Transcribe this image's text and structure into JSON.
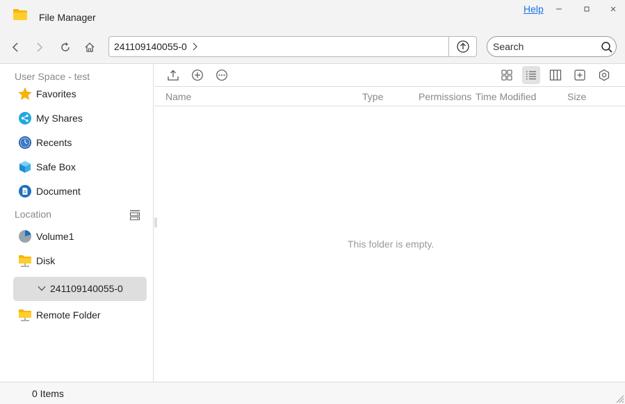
{
  "window": {
    "title": "File Manager",
    "help_label": "Help",
    "minimize_icon": "minimize-icon",
    "maximize_icon": "maximize-icon",
    "close_icon": "close-icon"
  },
  "navbar": {
    "back_icon": "chevron-left-icon",
    "forward_icon": "chevron-right-icon",
    "refresh_icon": "refresh-icon",
    "home_icon": "home-icon",
    "path": "241109140055-0",
    "up_icon": "upload-circle-icon",
    "search": {
      "placeholder": "Search",
      "value": ""
    }
  },
  "sidebar": {
    "user_space_label": "User Space - test",
    "items": [
      {
        "label": "Favorites",
        "icon": "star-icon"
      },
      {
        "label": "My Shares",
        "icon": "share-icon"
      },
      {
        "label": "Recents",
        "icon": "clock-icon"
      },
      {
        "label": "Safe Box",
        "icon": "cube-icon"
      },
      {
        "label": "Document",
        "icon": "document-icon"
      }
    ],
    "location_label": "Location",
    "locations": [
      {
        "label": "Volume1",
        "icon": "pie-disk-icon"
      },
      {
        "label": "Disk",
        "icon": "folder-icon"
      }
    ],
    "selected_device": "241109140055-0",
    "remote_folder_label": "Remote Folder"
  },
  "content": {
    "toolbar_icons": [
      "upload-icon",
      "add-circle-icon",
      "more-icon",
      "grid-view-icon",
      "list-view-icon",
      "column-view-icon",
      "new-folder-icon",
      "settings-icon"
    ],
    "columns": [
      "Name",
      "Type",
      "Permissions",
      "Time Modified",
      "Size"
    ],
    "empty_message": "This folder is empty."
  },
  "status": {
    "items_count": "0 Items"
  },
  "colors": {
    "accent": "#1a73e8",
    "folder": "#f7c12e",
    "selected_bg": "#dedede"
  }
}
